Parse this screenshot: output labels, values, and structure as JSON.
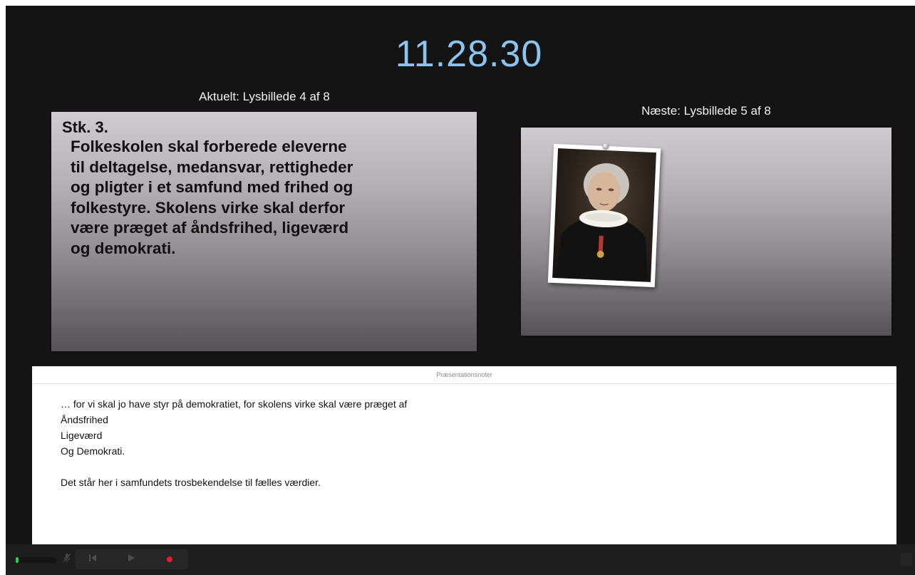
{
  "clock": {
    "time": "11.28.30",
    "color": "#8cc4ef"
  },
  "current_slide": {
    "label": "Aktuelt: Lysbillede 4 af 8",
    "title": "Stk. 3.",
    "body": "Folkeskolen skal forberede eleverne\ntil deltagelse, medansvar, rettigheder\nog pligter i et samfund med frihed og\nfolkestyre. Skolens virke skal derfor\nvære præget af åndsfrihed, ligeværd\nog demokrati."
  },
  "next_slide": {
    "label": "Næste: Lysbillede 5 af 8",
    "image": "portrait-photo"
  },
  "notes": {
    "header": "Præsentationsnoter",
    "lines": [
      "… for vi skal jo have styr på demokratiet, for skolens virke skal være præget af",
      "Åndsfrihed",
      "Ligeværd",
      "Og Demokrati.",
      "",
      "Det står her i samfundets trosbekendelse til fælles værdier."
    ]
  },
  "toolbar": {
    "icons": {
      "microphone": "microphone-muted-icon",
      "previous": "skip-back-icon",
      "play": "play-icon",
      "record": "record-icon"
    },
    "record_color": "#e3202a",
    "level_color": "#2bd04a"
  }
}
